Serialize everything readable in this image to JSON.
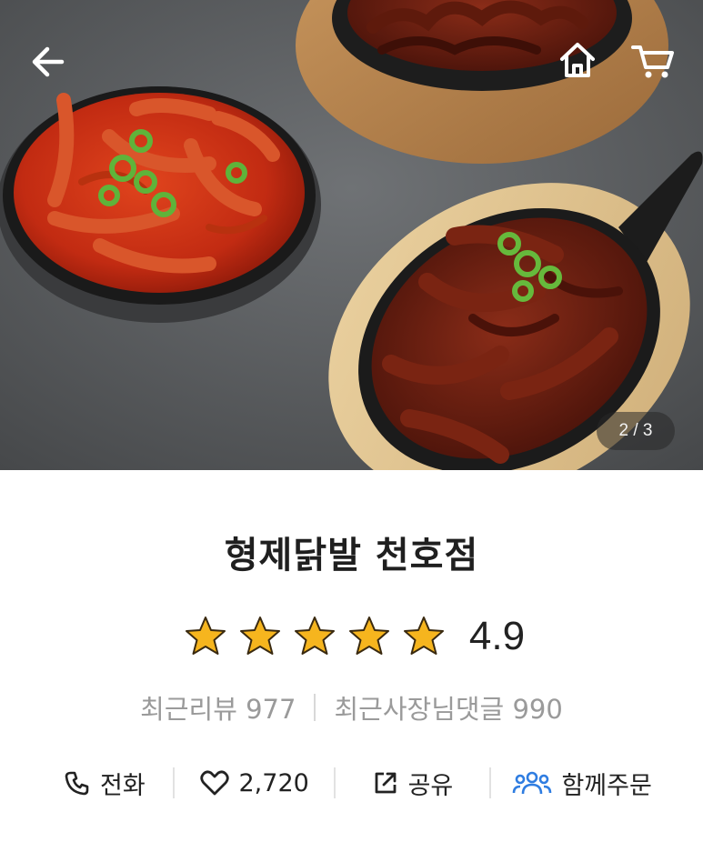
{
  "header": {
    "back_icon": "arrow-left-icon",
    "home_icon": "home-icon",
    "cart_icon": "cart-icon",
    "pager": "2 / 3"
  },
  "store": {
    "name": "형제닭발 천호점",
    "rating": "4.9",
    "star_count": 5,
    "star_color": "#f6b51e",
    "recent_reviews": "최근리뷰 977",
    "recent_owner_replies": "최근사장님댓글 990"
  },
  "actions": {
    "call_label": "전화",
    "like_count": "2,720",
    "share_label": "공유",
    "group_order_label": "함께주문",
    "group_order_color": "#2f7de1"
  }
}
